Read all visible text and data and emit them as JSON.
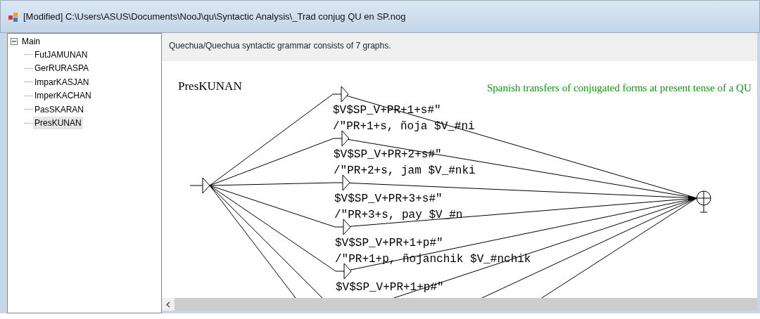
{
  "window": {
    "title": "[Modified] C:\\Users\\ASUS\\Documents\\NooJ\\qu\\Syntactic Analysis\\_Trad conjug QU en SP.nog"
  },
  "tree": {
    "label": "Main",
    "expanded": true,
    "children": [
      {
        "label": "FutJAMUNAN",
        "selected": false
      },
      {
        "label": "GerRURASPA",
        "selected": false
      },
      {
        "label": "ImparKASJAN",
        "selected": false
      },
      {
        "label": "ImperKACHAN",
        "selected": false
      },
      {
        "label": "PasSKARAN",
        "selected": false
      },
      {
        "label": "PresKUNAN",
        "selected": true
      }
    ]
  },
  "info": "Quechua/Quechua syntactic grammar consists of 7 graphs.",
  "graph": {
    "title": "PresKUNAN",
    "comment": "Spanish transfers of conjugated forms at present tense of a QU",
    "boxes": [
      {
        "lines": [
          "$V$SP_V+PR+1+s#\"",
          "/\"PR+1+s, ñoja $V_#ni"
        ]
      },
      {
        "lines": [
          "$V$SP_V+PR+2+s#\"",
          "/\"PR+2+s, jam $V_#nki"
        ]
      },
      {
        "lines": [
          "$V$SP_V+PR+3+s#\"",
          "/\"PR+3+s, pay $V_#n"
        ]
      },
      {
        "lines": [
          "$V$SP_V+PR+1+p#\"",
          "/\"PR+1+p, ñojanchik $V_#nchik"
        ]
      },
      {
        "lines": [
          "$V$SP_V+PR+1+p#\""
        ]
      }
    ]
  }
}
